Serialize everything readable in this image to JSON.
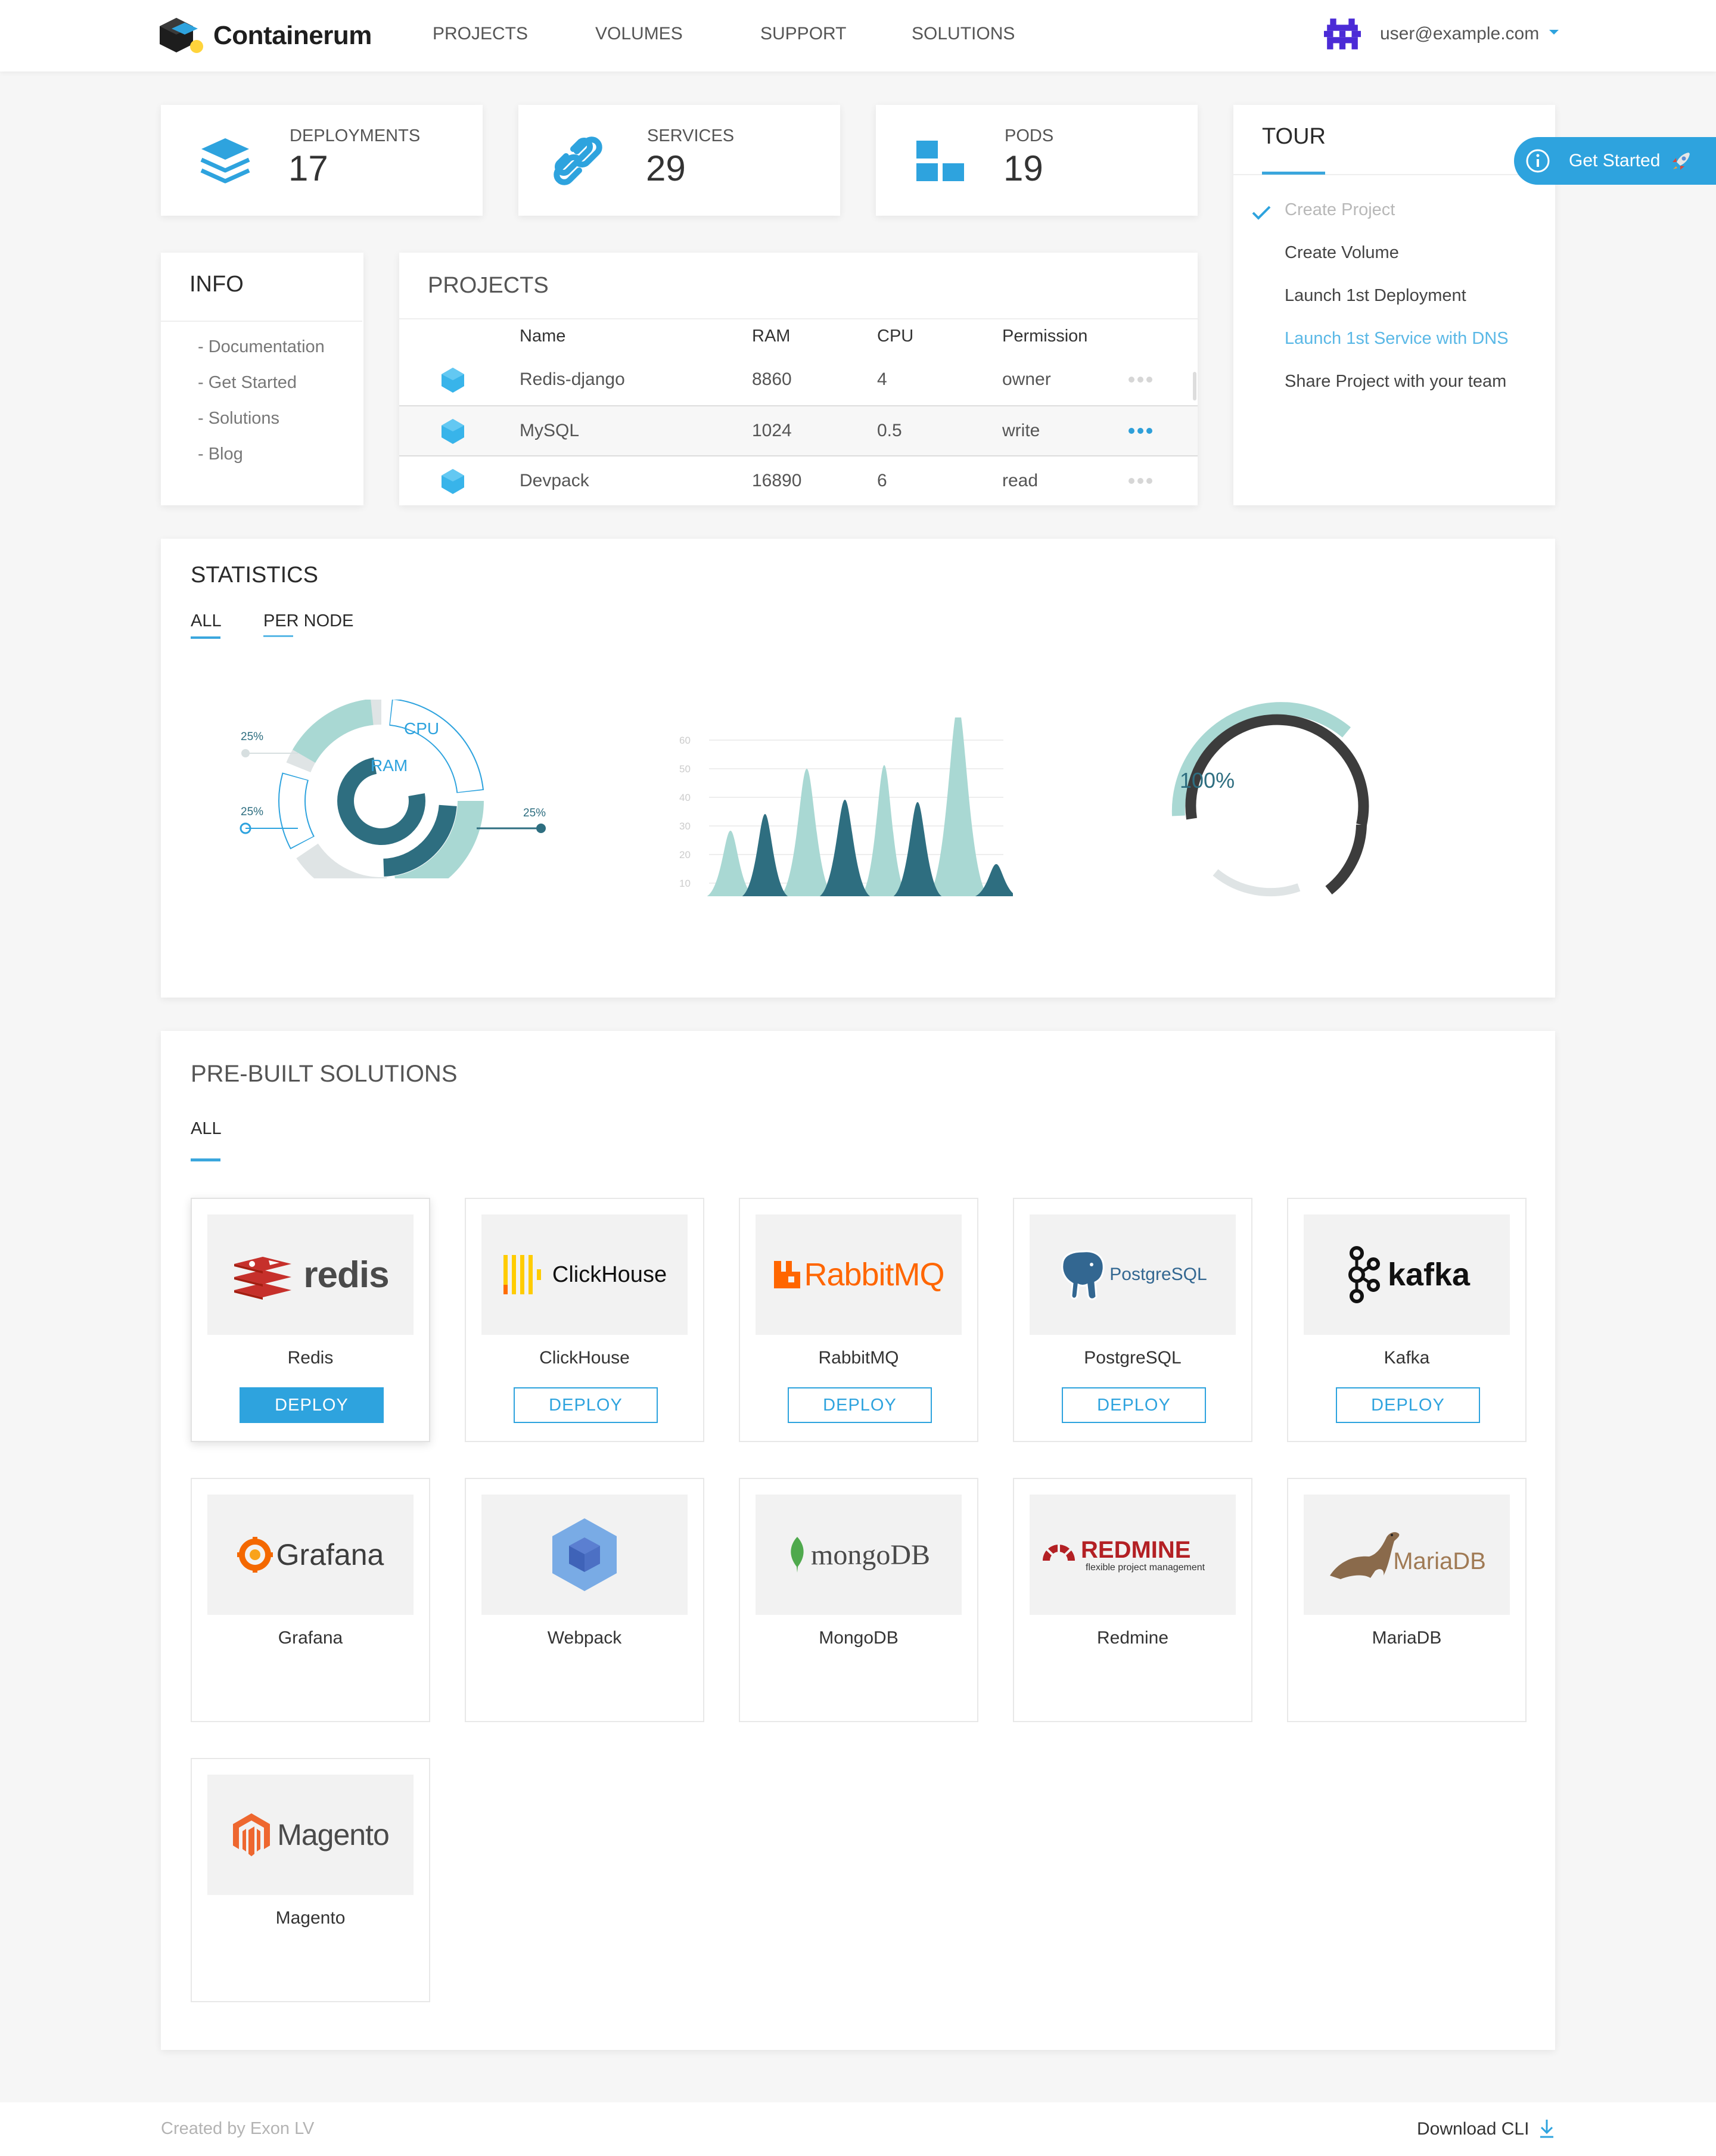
{
  "header": {
    "brand": "Containerum",
    "nav": [
      "PROJECTS",
      "VOLUMES",
      "SUPPORT",
      "SOLUTIONS"
    ],
    "user_email": "user@example.com"
  },
  "stats": [
    {
      "label": "DEPLOYMENTS",
      "value": "17",
      "icon": "layers-icon"
    },
    {
      "label": "SERVICES",
      "value": "29",
      "icon": "link-icon"
    },
    {
      "label": "PODS",
      "value": "19",
      "icon": "pods-icon"
    }
  ],
  "tour": {
    "title": "TOUR",
    "button": "Get Started",
    "items": [
      {
        "label": "Create Project",
        "state": "done"
      },
      {
        "label": "Create Volume",
        "state": "todo"
      },
      {
        "label": "Launch 1st Deployment",
        "state": "todo"
      },
      {
        "label": "Launch 1st Service with DNS",
        "state": "active"
      },
      {
        "label": "Share Project with your team",
        "state": "todo"
      }
    ]
  },
  "info": {
    "title": "INFO",
    "links": [
      "- Documentation",
      "- Get Started",
      "- Solutions",
      "- Blog"
    ]
  },
  "projects": {
    "title": "PROJECTS",
    "columns": [
      "Name",
      "RAM",
      "CPU",
      "Permission"
    ],
    "rows": [
      {
        "name": "Redis-django",
        "ram": "8860",
        "cpu": "4",
        "permission": "owner"
      },
      {
        "name": "MySQL",
        "ram": "1024",
        "cpu": "0.5",
        "permission": "write"
      },
      {
        "name": "Devpack",
        "ram": "16890",
        "cpu": "6",
        "permission": "read"
      }
    ]
  },
  "statistics": {
    "title": "STATISTICS",
    "tabs": [
      "ALL",
      "PER NODE"
    ]
  },
  "chart_data": [
    {
      "type": "pie",
      "labels": [
        "CPU",
        "RAM"
      ],
      "annotations": [
        "25%",
        "25%",
        "25%"
      ]
    },
    {
      "type": "area",
      "y_ticks": [
        60,
        50,
        40,
        30,
        20,
        10
      ],
      "ylim": [
        10,
        60
      ]
    },
    {
      "type": "pie",
      "annotations": [
        "100%"
      ]
    }
  ],
  "solutions": {
    "title": "PRE-BUILT SOLUTIONS",
    "tab": "ALL",
    "deploy_label": "DEPLOY",
    "items": [
      {
        "name": "Redis",
        "logo": "redis",
        "deploy": true
      },
      {
        "name": "ClickHouse",
        "logo": "ClickHouse",
        "deploy": true
      },
      {
        "name": "RabbitMQ",
        "logo": "RabbitMQ",
        "deploy": true
      },
      {
        "name": "PostgreSQL",
        "logo": "PostgreSQL",
        "deploy": true
      },
      {
        "name": "Kafka",
        "logo": "kafka",
        "deploy": true
      },
      {
        "name": "Grafana",
        "logo": "Grafana",
        "deploy": false
      },
      {
        "name": "Webpack",
        "logo": "",
        "deploy": false
      },
      {
        "name": "MongoDB",
        "logo": "mongoDB",
        "deploy": false
      },
      {
        "name": "Redmine",
        "logo": "REDMINE",
        "logo_sub": "flexible project management",
        "deploy": false
      },
      {
        "name": "MariaDB",
        "logo": "MariaDB",
        "deploy": false
      },
      {
        "name": "Magento",
        "logo": "Magento",
        "deploy": false
      }
    ]
  },
  "footer": {
    "credit": "Created by Exon LV",
    "download": "Download CLI"
  },
  "colors": {
    "accent": "#2ea3de",
    "teal_light": "#a9d8d3",
    "teal_dark": "#2e6e80",
    "gauge_dark": "#3c3c3c"
  }
}
